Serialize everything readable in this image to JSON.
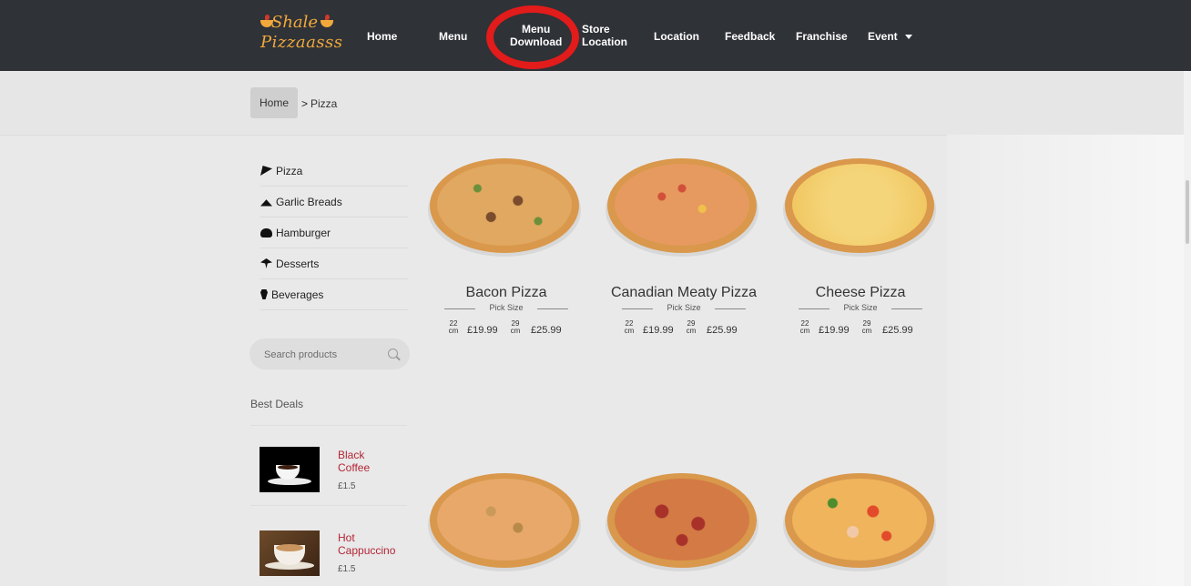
{
  "logo": {
    "line1": "Shale",
    "line2": "Pizzaasss"
  },
  "nav": {
    "home": "Home",
    "menu": "Menu",
    "menu_download_1": "Menu",
    "menu_download_2": "Download",
    "store_location_1": "Store",
    "store_location_2": "Location",
    "location": "Location",
    "feedback": "Feedback",
    "franchise": "Franchise",
    "event": "Event"
  },
  "breadcrumb": {
    "home": "Home",
    "separator": ">",
    "current": "Pizza"
  },
  "categories": [
    {
      "label": "Pizza",
      "icon": "pizza-icon"
    },
    {
      "label": "Garlic Breads",
      "icon": "bread-icon"
    },
    {
      "label": "Hamburger",
      "icon": "burger-icon"
    },
    {
      "label": "Desserts",
      "icon": "dessert-icon"
    },
    {
      "label": "Beverages",
      "icon": "beverage-icon"
    }
  ],
  "search": {
    "placeholder": "Search products"
  },
  "best_deals": {
    "title": "Best Deals",
    "items": [
      {
        "name_1": "Black",
        "name_2": "Coffee",
        "price": "£1.5"
      },
      {
        "name_1": "Hot",
        "name_2": "Cappuccino",
        "price": "£1.5"
      }
    ]
  },
  "products": [
    {
      "name": "Bacon Pizza",
      "pick": "Pick Size",
      "size1": "22",
      "unit1": "cm",
      "price1": "£19.99",
      "size2": "29",
      "unit2": "cm",
      "price2": "£25.99"
    },
    {
      "name": "Canadian Meaty Pizza",
      "pick": "Pick Size",
      "size1": "22",
      "unit1": "cm",
      "price1": "£19.99",
      "size2": "29",
      "unit2": "cm",
      "price2": "£25.99"
    },
    {
      "name": "Cheese Pizza",
      "pick": "Pick Size",
      "size1": "22",
      "unit1": "cm",
      "price1": "£19.99",
      "size2": "29",
      "unit2": "cm",
      "price2": "£25.99"
    }
  ],
  "colors": {
    "nav_bg": "#2f3237",
    "accent_red": "#e21b1b",
    "deal_name": "#b22635",
    "logo": "#f2a93b"
  }
}
